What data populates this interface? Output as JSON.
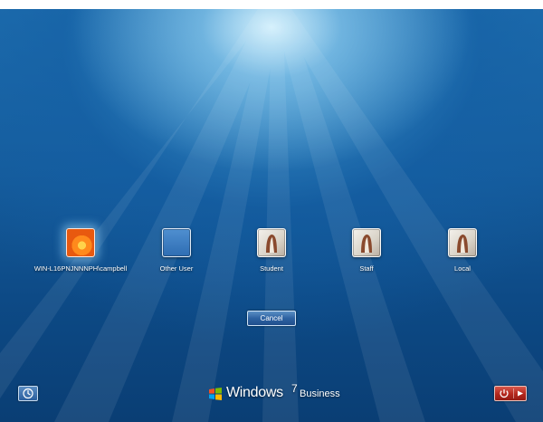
{
  "users": [
    {
      "name": "WIN-L16PNJNNNPH\\campbell",
      "picture": "flower-picture",
      "selected": true
    },
    {
      "name": "Other User",
      "picture": "blank-picture",
      "selected": false
    },
    {
      "name": "Student",
      "picture": "default-user-picture",
      "selected": false
    },
    {
      "name": "Staff",
      "picture": "default-user-picture",
      "selected": false
    },
    {
      "name": "Local",
      "picture": "default-user-picture",
      "selected": false
    }
  ],
  "cancel_label": "Cancel",
  "branding": {
    "word": "Windows",
    "version": "7",
    "edition": "Business"
  },
  "icons": {
    "ease_of_access": "ease-of-access-icon",
    "shutdown": "power-icon",
    "shutdown_options": "arrow-right-icon"
  },
  "colors": {
    "background": "#1a64a6",
    "shutdown": "#c0392b"
  }
}
